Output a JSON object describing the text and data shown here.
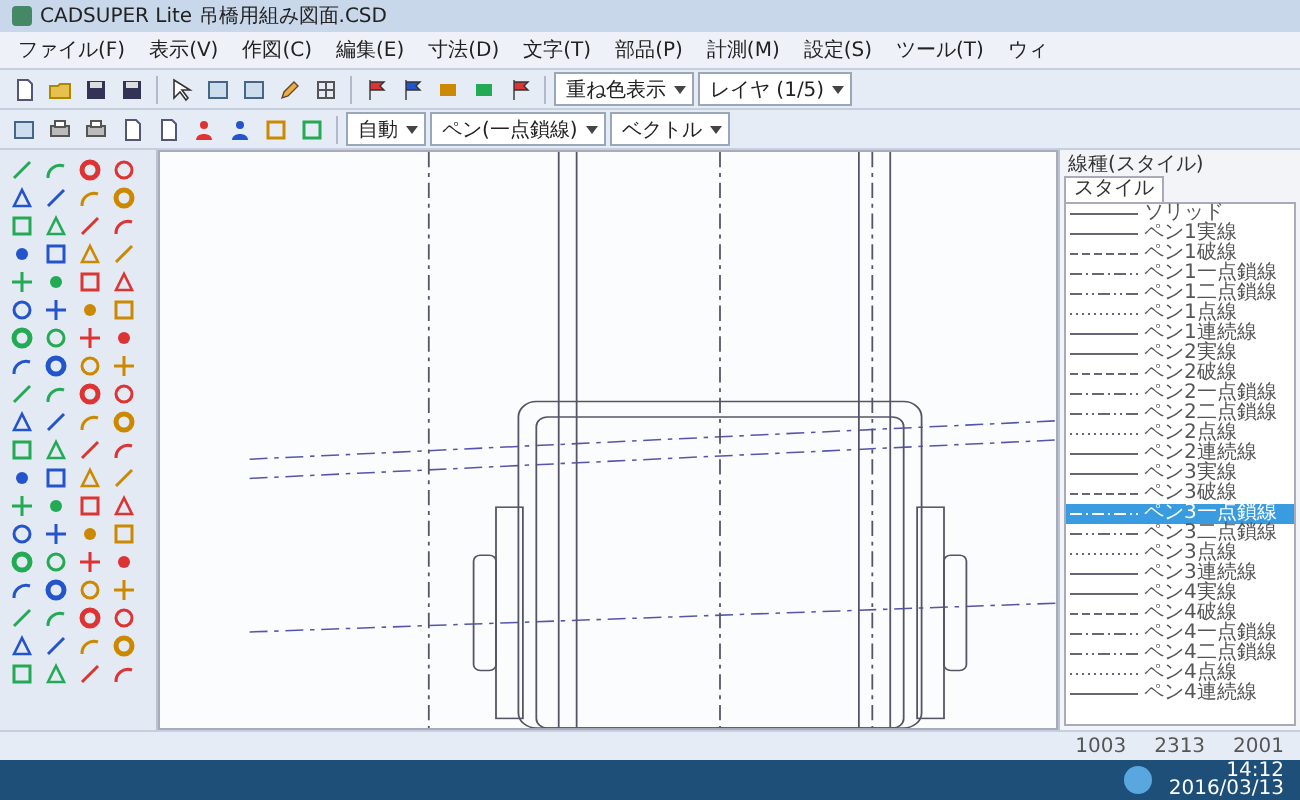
{
  "window": {
    "title": "CADSUPER Lite 吊橋用組み図面.CSD"
  },
  "menu": [
    "ファイル(F)",
    "表示(V)",
    "作図(C)",
    "編集(E)",
    "寸法(D)",
    "文字(T)",
    "部品(P)",
    "計測(M)",
    "設定(S)",
    "ツール(T)",
    "ウィ"
  ],
  "toolbar": {
    "combos": [
      {
        "value": "重ね色表示"
      },
      {
        "value": "レイヤ (1/5)"
      }
    ]
  },
  "toolbar2": {
    "combos": [
      {
        "value": "自動"
      },
      {
        "value": "ペン(一点鎖線)"
      },
      {
        "value": "ベクトル"
      }
    ]
  },
  "style_panel": {
    "title": "線種(スタイル)",
    "tab": "スタイル",
    "items": [
      {
        "label": "ソリッド",
        "kind": "solid",
        "selected": false
      },
      {
        "label": "ペン1実線",
        "kind": "solid",
        "selected": false
      },
      {
        "label": "ペン1破線",
        "kind": "dashed",
        "selected": false
      },
      {
        "label": "ペン1一点鎖線",
        "kind": "dashdot",
        "selected": false
      },
      {
        "label": "ペン1二点鎖線",
        "kind": "dashdotdot",
        "selected": false
      },
      {
        "label": "ペン1点線",
        "kind": "dotted",
        "selected": false
      },
      {
        "label": "ペン1連続線",
        "kind": "solid",
        "selected": false
      },
      {
        "label": "ペン2実線",
        "kind": "solid",
        "selected": false
      },
      {
        "label": "ペン2破線",
        "kind": "dashed",
        "selected": false
      },
      {
        "label": "ペン2一点鎖線",
        "kind": "dashdot",
        "selected": false
      },
      {
        "label": "ペン2二点鎖線",
        "kind": "dashdotdot",
        "selected": false
      },
      {
        "label": "ペン2点線",
        "kind": "dotted",
        "selected": false
      },
      {
        "label": "ペン2連続線",
        "kind": "solid",
        "selected": false
      },
      {
        "label": "ペン3実線",
        "kind": "solid",
        "selected": false
      },
      {
        "label": "ペン3破線",
        "kind": "dashed",
        "selected": false
      },
      {
        "label": "ペン3一点鎖線",
        "kind": "dashdot",
        "selected": true
      },
      {
        "label": "ペン3二点鎖線",
        "kind": "dashdotdot",
        "selected": false
      },
      {
        "label": "ペン3点線",
        "kind": "dotted",
        "selected": false
      },
      {
        "label": "ペン3連続線",
        "kind": "solid",
        "selected": false
      },
      {
        "label": "ペン4実線",
        "kind": "solid",
        "selected": false
      },
      {
        "label": "ペン4破線",
        "kind": "dashed",
        "selected": false
      },
      {
        "label": "ペン4一点鎖線",
        "kind": "dashdot",
        "selected": false
      },
      {
        "label": "ペン4二点鎖線",
        "kind": "dashdotdot",
        "selected": false
      },
      {
        "label": "ペン4点線",
        "kind": "dotted",
        "selected": false
      },
      {
        "label": "ペン4連続線",
        "kind": "solid",
        "selected": false
      }
    ]
  },
  "status_bar": {
    "readings": [
      "1003",
      "2313",
      "2001"
    ]
  },
  "taskbar": {
    "time": "14:12",
    "date": "2016/03/13"
  }
}
